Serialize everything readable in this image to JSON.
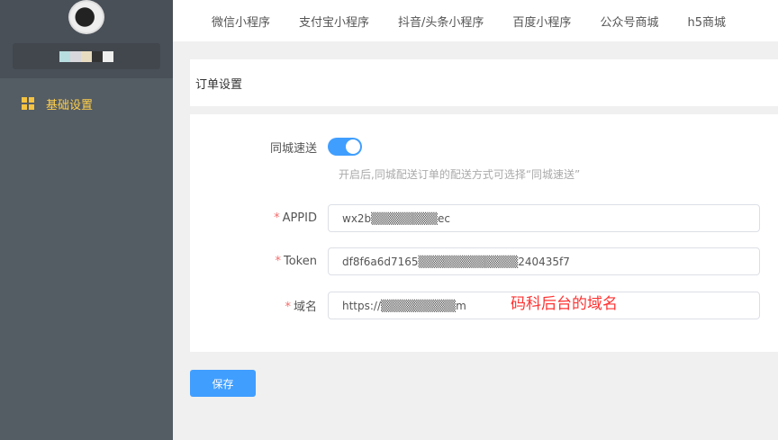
{
  "sidebar": {
    "menu": [
      {
        "label": "基础设置",
        "icon": "grid-icon"
      }
    ]
  },
  "topnav": {
    "tabs": [
      "微信小程序",
      "支付宝小程序",
      "抖音/头条小程序",
      "百度小程序",
      "公众号商城",
      "h5商城"
    ]
  },
  "card": {
    "title": "订单设置"
  },
  "form": {
    "same_city": {
      "label": "同城速送",
      "enabled": true,
      "hint": "开启后,同城配送订单的配送方式可选择“同城速送”"
    },
    "appid": {
      "label": "APPID",
      "value": "wx2b▒▒▒▒▒▒▒▒ec"
    },
    "token": {
      "label": "Token",
      "value": "df8f6a6d7165▒▒▒▒▒▒▒▒▒▒▒▒240435f7"
    },
    "domain": {
      "label": "域名",
      "value": "https://▒▒▒▒▒▒▒▒▒m"
    },
    "required_mark": "*",
    "annotation": "码科后台的域名"
  },
  "save_label": "保存",
  "colors": {
    "accent": "#409eff",
    "sidebar": "#545c64",
    "active_menu": "#ffd04b",
    "annotation": "#ff3333"
  }
}
